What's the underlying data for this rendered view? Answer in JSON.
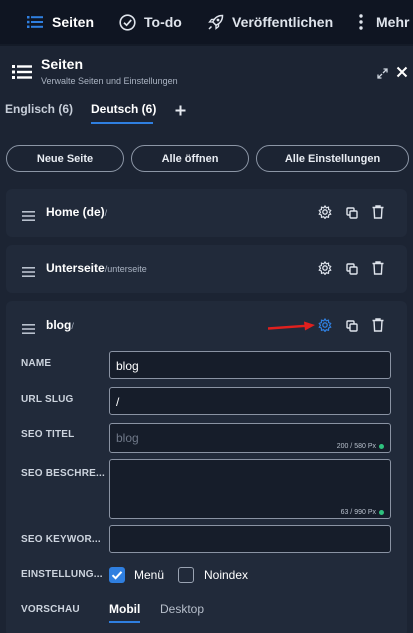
{
  "topnav": {
    "items": [
      {
        "label": "Seiten",
        "icon": "list-icon"
      },
      {
        "label": "To-do",
        "icon": "check-circle-icon"
      },
      {
        "label": "Veröffentlichen",
        "icon": "rocket-icon"
      },
      {
        "label": "Mehr",
        "icon": "more-vertical-icon"
      }
    ]
  },
  "panel": {
    "title": "Seiten",
    "subtitle": "Verwalte Seiten und Einstellungen"
  },
  "tabs": [
    {
      "label": "Englisch (6)"
    },
    {
      "label": "Deutsch (6)"
    }
  ],
  "actions": {
    "new_page": "Neue Seite",
    "open_all": "Alle öffnen",
    "all_settings": "Alle Einstellungen"
  },
  "pages": [
    {
      "title": "Home (de)",
      "path": "/"
    },
    {
      "title": "Unterseite",
      "path": "/unterseite"
    },
    {
      "title": "blog",
      "path": "/"
    }
  ],
  "form": {
    "name_label": "NAME",
    "name_value": "blog",
    "slug_label": "URL SLUG",
    "slug_value": "/",
    "seo_title_label": "SEO TITEL",
    "seo_title_placeholder": "blog",
    "seo_title_counter": "200 / 580 Px",
    "seo_desc_label": "SEO BESCHRE...",
    "seo_desc_counter": "63 / 990 Px",
    "seo_keywords_label": "SEO KEYWOR...",
    "settings_label": "EINSTELLUNG...",
    "menu_label": "Menü",
    "noindex_label": "Noindex",
    "preview_label": "VORSCHAU",
    "preview_tabs": [
      "Mobil",
      "Desktop"
    ]
  },
  "colors": {
    "accent": "#2f7fe0",
    "arrow": "#e0201e",
    "ok_dot": "#2ec27e"
  }
}
